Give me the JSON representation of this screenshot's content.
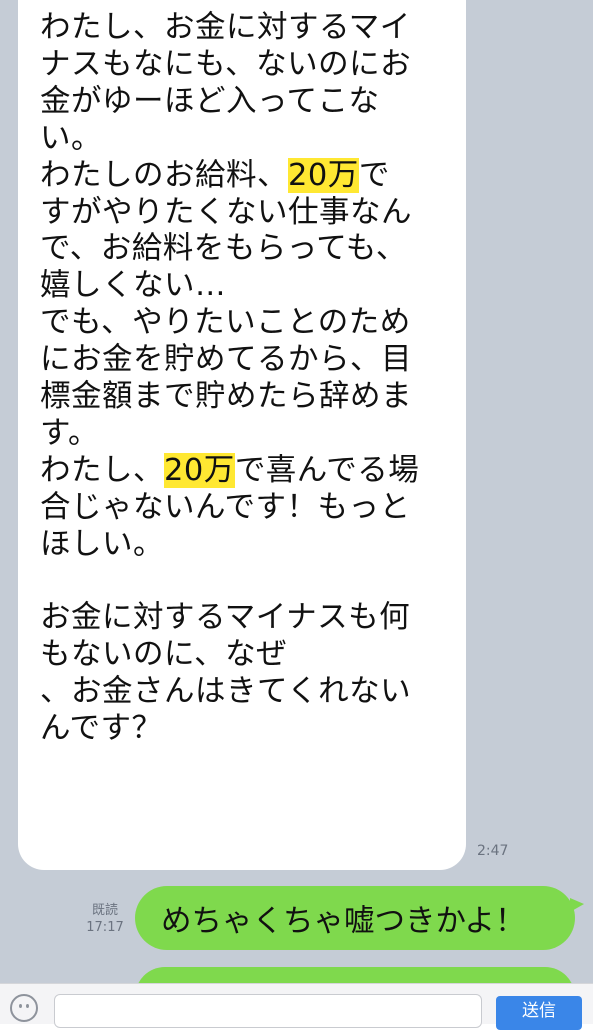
{
  "incoming_message": {
    "lines": [
      [
        {
          "t": "わたし、お金に対するマイ"
        }
      ],
      [
        {
          "t": "ナスもなにも、ないのにお"
        }
      ],
      [
        {
          "t": "金がゆーほど入ってこな"
        }
      ],
      [
        {
          "t": "い。"
        }
      ],
      [
        {
          "t": "わたしのお給料、"
        },
        {
          "t": "20万",
          "hl": true
        },
        {
          "t": "で"
        }
      ],
      [
        {
          "t": "すがやりたくない仕事なん"
        }
      ],
      [
        {
          "t": "で、お給料をもらっても、"
        }
      ],
      [
        {
          "t": "嬉しくない…"
        }
      ],
      [
        {
          "t": "でも、やりたいことのため"
        }
      ],
      [
        {
          "t": "にお金を貯めてるから、目"
        }
      ],
      [
        {
          "t": "標金額まで貯めたら辞めま"
        }
      ],
      [
        {
          "t": "す。"
        }
      ],
      [
        {
          "t": "わたし、"
        },
        {
          "t": "20万",
          "hl": true
        },
        {
          "t": "で喜んでる場"
        }
      ],
      [
        {
          "t": "合じゃないんです！もっと"
        }
      ],
      [
        {
          "t": "ほしい。"
        }
      ],
      [],
      [
        {
          "t": "お金に対するマイナスも何"
        }
      ],
      [
        {
          "t": "もないのに、なぜ"
        }
      ],
      [
        {
          "t": "、お金さんはきてくれない"
        }
      ],
      [
        {
          "t": "んです？"
        }
      ]
    ],
    "time": "2:47"
  },
  "outgoing_message": {
    "read_label": "既読",
    "time": "17:17",
    "text": "めちゃくちゃ嘘つきかよ！"
  },
  "input_bar": {
    "placeholder": "",
    "send_label": "送信"
  },
  "colors": {
    "chat_background": "#c5ccd6",
    "incoming_bubble": "#ffffff",
    "outgoing_bubble": "#7fd94d",
    "highlight": "#ffe832",
    "send_button": "#3a86e8"
  },
  "icons": [
    "emoji-icon"
  ]
}
